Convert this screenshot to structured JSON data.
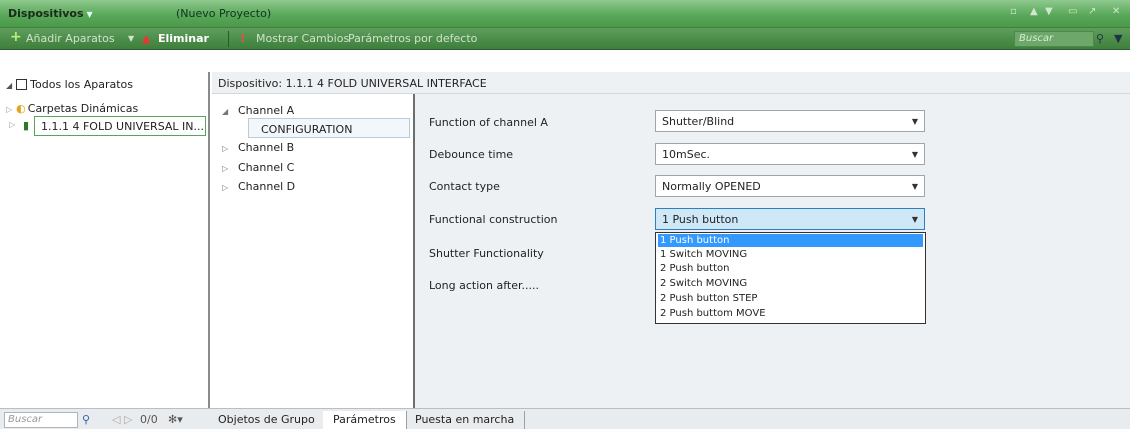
{
  "titlebar": {
    "title": "Dispositivos",
    "title_arrow": "▼",
    "project": "(Nuevo Proyecto)",
    "controls": [
      "▫",
      "▲",
      "▼",
      "▭",
      "↗",
      "✕"
    ]
  },
  "toolbar": {
    "add_label": "Añadir Aparatos",
    "add_arrow": "▼",
    "delete_label": "Eliminar",
    "show_changes_label": "Mostrar Cambios",
    "default_params_label": "Parámetros por defecto",
    "search_placeholder": "Buscar"
  },
  "tree": {
    "all_devices": "Todos los Aparatos",
    "dynamic_folders": "Carpetas Dinámicas",
    "device": "1.1.1  4 FOLD UNIVERSAL IN..."
  },
  "bottom": {
    "search_placeholder": "Buscar",
    "counter": "0/0",
    "tabs": [
      "Objetos de Grupo",
      "Parámetros",
      "Puesta en marcha"
    ]
  },
  "device_header": "Dispositivo: 1.1.1  4 FOLD UNIVERSAL INTERFACE",
  "channels": {
    "a": "Channel A",
    "config": "CONFIGURATION",
    "b": "Channel B",
    "c": "Channel C",
    "d": "Channel D"
  },
  "params": [
    {
      "label": "Function of channel A",
      "value": "Shutter/Blind"
    },
    {
      "label": "Debounce time",
      "value": "10mSec."
    },
    {
      "label": "Contact type",
      "value": "Normally OPENED"
    },
    {
      "label": "Functional construction",
      "value": "1 Push button"
    },
    {
      "label": "Shutter Functionality"
    },
    {
      "label": "Long action after....."
    }
  ],
  "dropdown_options": [
    "1 Push button",
    "1 Switch MOVING",
    "2 Push button",
    "2 Switch MOVING",
    "2 Push button STEP",
    "2 Push buttom MOVE"
  ],
  "colors": {
    "title_green": "#5aa85a",
    "toolbar_green": "#3e7f3c",
    "selection_blue": "#3399ff"
  }
}
